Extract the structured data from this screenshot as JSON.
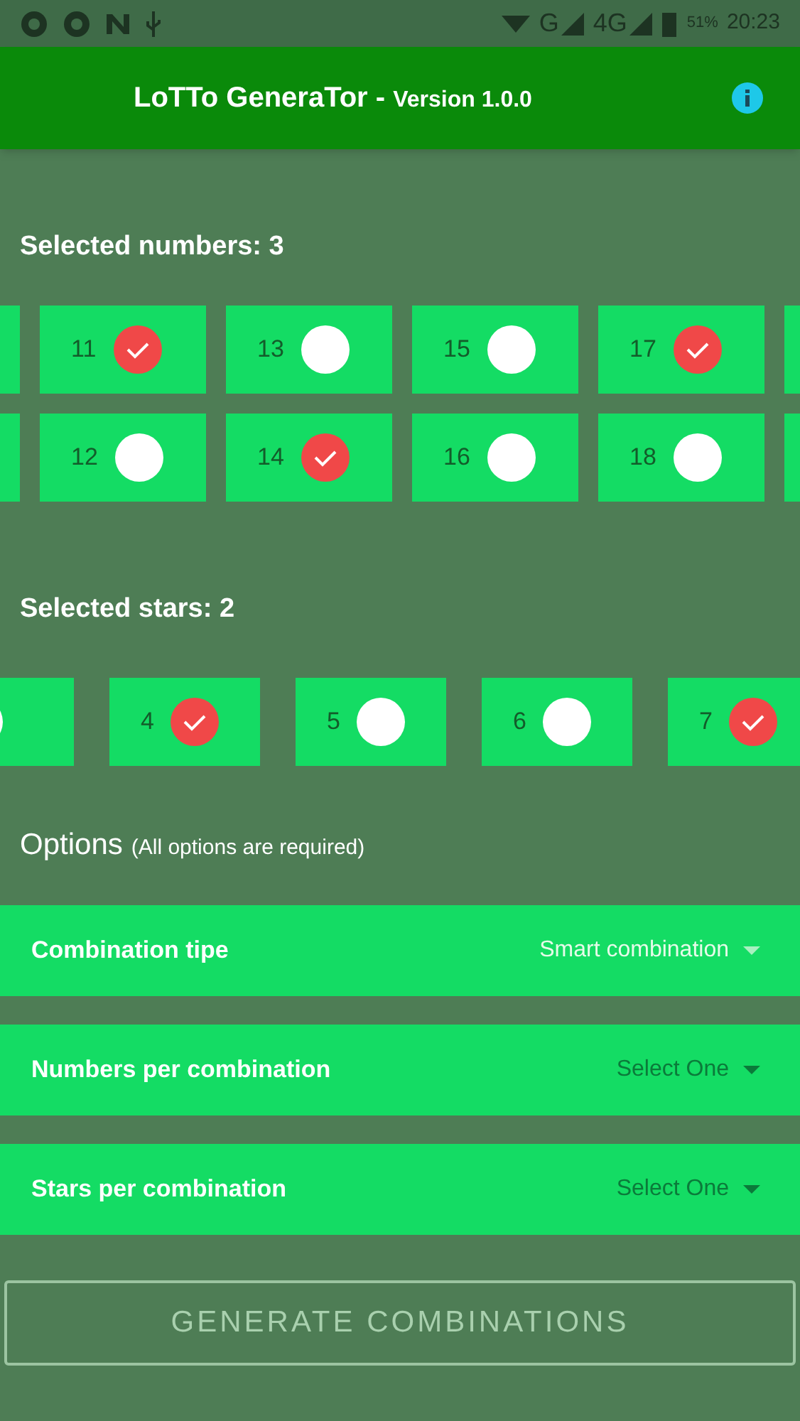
{
  "status_bar": {
    "networks": [
      "G",
      "4G"
    ],
    "battery": "51%",
    "time": "20:23"
  },
  "app_bar": {
    "title": "LoTTo GeneraTor - ",
    "version": "Version 1.0.0"
  },
  "numbers": {
    "heading": "Selected numbers: 3",
    "rows": [
      [
        {},
        {
          "label": "11",
          "checked": true
        },
        {
          "label": "13",
          "checked": false
        },
        {
          "label": "15",
          "checked": false
        },
        {
          "label": "17",
          "checked": true
        },
        {}
      ],
      [
        {},
        {
          "label": "12",
          "checked": false
        },
        {
          "label": "14",
          "checked": true
        },
        {
          "label": "16",
          "checked": false
        },
        {
          "label": "18",
          "checked": false
        },
        {}
      ]
    ]
  },
  "stars": {
    "heading": "Selected stars: 2",
    "items": [
      {
        "checked": false
      },
      {
        "label": "4",
        "checked": true
      },
      {
        "label": "5",
        "checked": false
      },
      {
        "label": "6",
        "checked": false
      },
      {
        "label": "7",
        "checked": true
      }
    ]
  },
  "options": {
    "heading": "Options",
    "note": "(All options are required)",
    "fields": [
      {
        "label": "Combination tipe",
        "value": "Smart combination"
      },
      {
        "label": "Numbers per combination",
        "placeholder": "Select One"
      },
      {
        "label": "Stars per combination",
        "placeholder": "Select One"
      }
    ]
  },
  "generate_button": {
    "label": "GENERATE COMBINATIONS",
    "disabled": true
  }
}
